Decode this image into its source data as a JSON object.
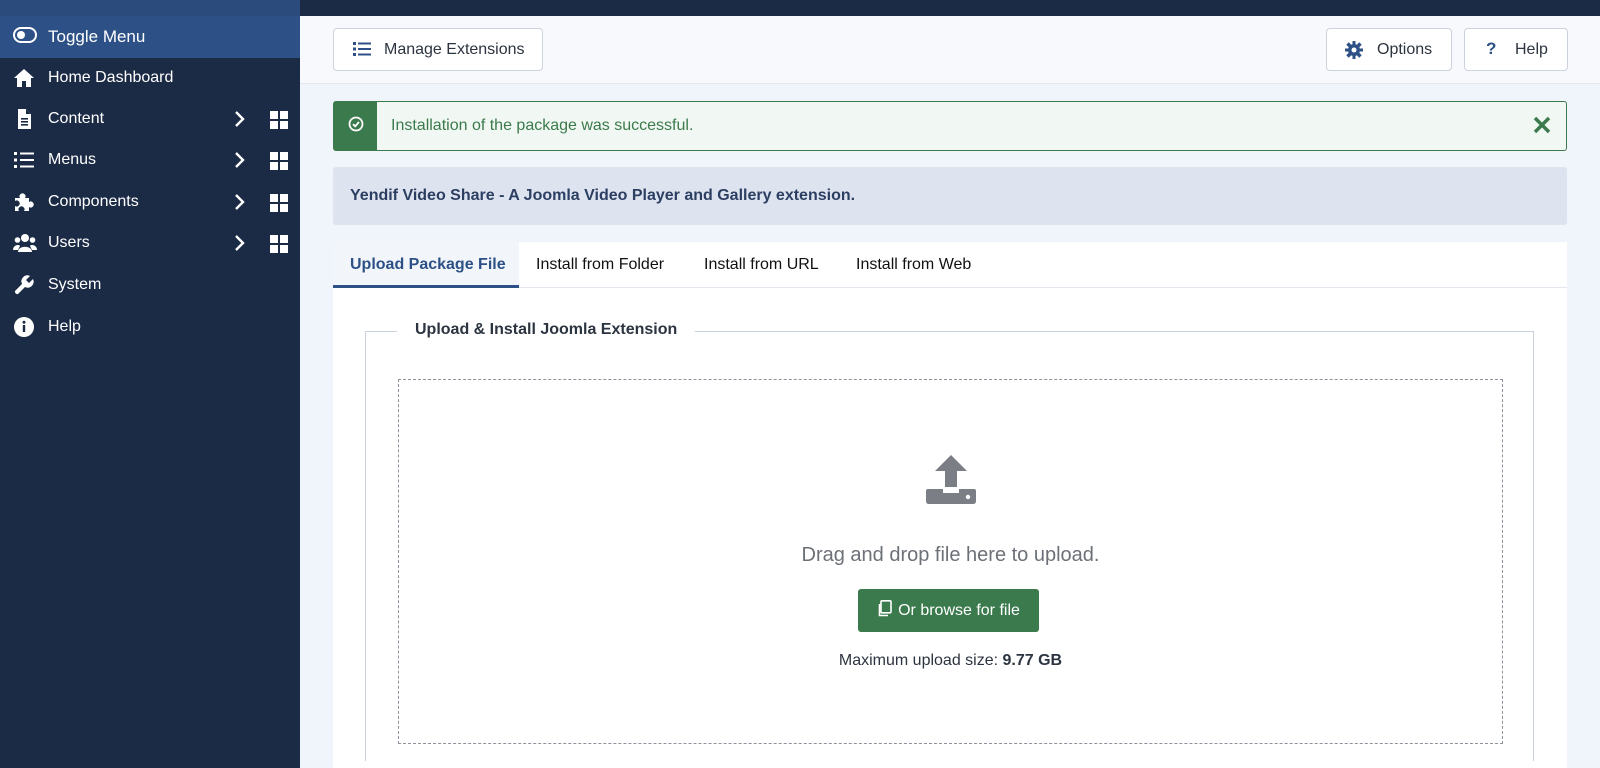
{
  "sidebar": {
    "toggle_label": "Toggle Menu",
    "items": [
      {
        "label": "Home Dashboard",
        "icon": "home-icon"
      },
      {
        "label": "Content",
        "icon": "file-icon"
      },
      {
        "label": "Menus",
        "icon": "list-icon"
      },
      {
        "label": "Components",
        "icon": "puzzle-icon"
      },
      {
        "label": "Users",
        "icon": "users-icon"
      },
      {
        "label": "System",
        "icon": "wrench-icon"
      },
      {
        "label": "Help",
        "icon": "info-icon"
      }
    ]
  },
  "toolbar": {
    "manage_label": "Manage Extensions",
    "options_label": "Options",
    "help_label": "Help"
  },
  "alert": {
    "message": "Installation of the package was successful.",
    "color": "#3b7a4c"
  },
  "info": {
    "text": "Yendif Video Share - A Joomla Video Player and Gallery extension."
  },
  "tabs": [
    {
      "label": "Upload Package File",
      "active": true
    },
    {
      "label": "Install from Folder",
      "active": false
    },
    {
      "label": "Install from URL",
      "active": false
    },
    {
      "label": "Install from Web",
      "active": false
    }
  ],
  "upload": {
    "legend": "Upload & Install Joomla Extension",
    "drop_text": "Drag and drop file here to upload.",
    "browse_label": "Or browse for file",
    "max_label": "Maximum upload size:",
    "max_value": "9.77 GB"
  },
  "colors": {
    "sidebar_bg": "#1c2b45",
    "accent": "#2d5186",
    "success": "#3b7a4c"
  }
}
